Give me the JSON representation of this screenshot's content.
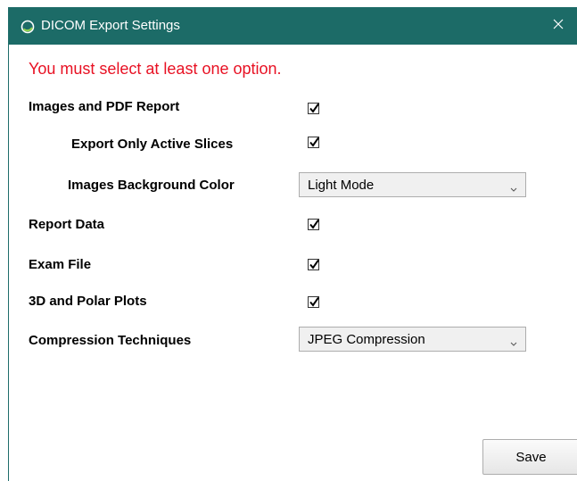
{
  "window": {
    "title": "DICOM Export Settings",
    "accent_color": "#1c6b67",
    "close_icon": "close-icon"
  },
  "error_message": "You must select at least one option.",
  "options": {
    "images_pdf_report": {
      "label": "Images and PDF Report",
      "checked": true
    },
    "export_only_active_slices": {
      "label": "Export Only Active Slices",
      "checked": true
    },
    "images_background_color": {
      "label": "Images Background Color",
      "selected": "Light Mode"
    },
    "report_data": {
      "label": "Report Data",
      "checked": true
    },
    "exam_file": {
      "label": "Exam File",
      "checked": true
    },
    "plots_3d_polar": {
      "label": "3D and Polar Plots",
      "checked": true
    },
    "compression_techniques": {
      "label": "Compression Techniques",
      "selected": "JPEG Compression"
    }
  },
  "buttons": {
    "save": "Save"
  }
}
